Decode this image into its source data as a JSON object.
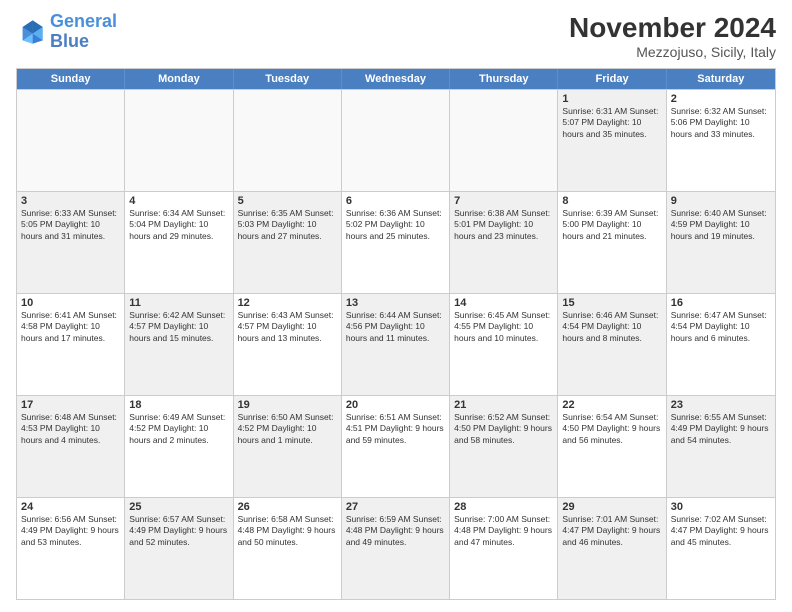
{
  "header": {
    "logo_line1": "General",
    "logo_line2": "Blue",
    "month_title": "November 2024",
    "location": "Mezzojuso, Sicily, Italy"
  },
  "days_of_week": [
    "Sunday",
    "Monday",
    "Tuesday",
    "Wednesday",
    "Thursday",
    "Friday",
    "Saturday"
  ],
  "rows": [
    [
      {
        "day": "",
        "info": "",
        "empty": true
      },
      {
        "day": "",
        "info": "",
        "empty": true
      },
      {
        "day": "",
        "info": "",
        "empty": true
      },
      {
        "day": "",
        "info": "",
        "empty": true
      },
      {
        "day": "",
        "info": "",
        "empty": true
      },
      {
        "day": "1",
        "info": "Sunrise: 6:31 AM\nSunset: 5:07 PM\nDaylight: 10 hours and 35 minutes.",
        "shaded": true
      },
      {
        "day": "2",
        "info": "Sunrise: 6:32 AM\nSunset: 5:06 PM\nDaylight: 10 hours and 33 minutes.",
        "shaded": false
      }
    ],
    [
      {
        "day": "3",
        "info": "Sunrise: 6:33 AM\nSunset: 5:05 PM\nDaylight: 10 hours and 31 minutes.",
        "shaded": true
      },
      {
        "day": "4",
        "info": "Sunrise: 6:34 AM\nSunset: 5:04 PM\nDaylight: 10 hours and 29 minutes.",
        "shaded": false
      },
      {
        "day": "5",
        "info": "Sunrise: 6:35 AM\nSunset: 5:03 PM\nDaylight: 10 hours and 27 minutes.",
        "shaded": true
      },
      {
        "day": "6",
        "info": "Sunrise: 6:36 AM\nSunset: 5:02 PM\nDaylight: 10 hours and 25 minutes.",
        "shaded": false
      },
      {
        "day": "7",
        "info": "Sunrise: 6:38 AM\nSunset: 5:01 PM\nDaylight: 10 hours and 23 minutes.",
        "shaded": true
      },
      {
        "day": "8",
        "info": "Sunrise: 6:39 AM\nSunset: 5:00 PM\nDaylight: 10 hours and 21 minutes.",
        "shaded": false
      },
      {
        "day": "9",
        "info": "Sunrise: 6:40 AM\nSunset: 4:59 PM\nDaylight: 10 hours and 19 minutes.",
        "shaded": true
      }
    ],
    [
      {
        "day": "10",
        "info": "Sunrise: 6:41 AM\nSunset: 4:58 PM\nDaylight: 10 hours and 17 minutes.",
        "shaded": false
      },
      {
        "day": "11",
        "info": "Sunrise: 6:42 AM\nSunset: 4:57 PM\nDaylight: 10 hours and 15 minutes.",
        "shaded": true
      },
      {
        "day": "12",
        "info": "Sunrise: 6:43 AM\nSunset: 4:57 PM\nDaylight: 10 hours and 13 minutes.",
        "shaded": false
      },
      {
        "day": "13",
        "info": "Sunrise: 6:44 AM\nSunset: 4:56 PM\nDaylight: 10 hours and 11 minutes.",
        "shaded": true
      },
      {
        "day": "14",
        "info": "Sunrise: 6:45 AM\nSunset: 4:55 PM\nDaylight: 10 hours and 10 minutes.",
        "shaded": false
      },
      {
        "day": "15",
        "info": "Sunrise: 6:46 AM\nSunset: 4:54 PM\nDaylight: 10 hours and 8 minutes.",
        "shaded": true
      },
      {
        "day": "16",
        "info": "Sunrise: 6:47 AM\nSunset: 4:54 PM\nDaylight: 10 hours and 6 minutes.",
        "shaded": false
      }
    ],
    [
      {
        "day": "17",
        "info": "Sunrise: 6:48 AM\nSunset: 4:53 PM\nDaylight: 10 hours and 4 minutes.",
        "shaded": true
      },
      {
        "day": "18",
        "info": "Sunrise: 6:49 AM\nSunset: 4:52 PM\nDaylight: 10 hours and 2 minutes.",
        "shaded": false
      },
      {
        "day": "19",
        "info": "Sunrise: 6:50 AM\nSunset: 4:52 PM\nDaylight: 10 hours and 1 minute.",
        "shaded": true
      },
      {
        "day": "20",
        "info": "Sunrise: 6:51 AM\nSunset: 4:51 PM\nDaylight: 9 hours and 59 minutes.",
        "shaded": false
      },
      {
        "day": "21",
        "info": "Sunrise: 6:52 AM\nSunset: 4:50 PM\nDaylight: 9 hours and 58 minutes.",
        "shaded": true
      },
      {
        "day": "22",
        "info": "Sunrise: 6:54 AM\nSunset: 4:50 PM\nDaylight: 9 hours and 56 minutes.",
        "shaded": false
      },
      {
        "day": "23",
        "info": "Sunrise: 6:55 AM\nSunset: 4:49 PM\nDaylight: 9 hours and 54 minutes.",
        "shaded": true
      }
    ],
    [
      {
        "day": "24",
        "info": "Sunrise: 6:56 AM\nSunset: 4:49 PM\nDaylight: 9 hours and 53 minutes.",
        "shaded": false
      },
      {
        "day": "25",
        "info": "Sunrise: 6:57 AM\nSunset: 4:49 PM\nDaylight: 9 hours and 52 minutes.",
        "shaded": true
      },
      {
        "day": "26",
        "info": "Sunrise: 6:58 AM\nSunset: 4:48 PM\nDaylight: 9 hours and 50 minutes.",
        "shaded": false
      },
      {
        "day": "27",
        "info": "Sunrise: 6:59 AM\nSunset: 4:48 PM\nDaylight: 9 hours and 49 minutes.",
        "shaded": true
      },
      {
        "day": "28",
        "info": "Sunrise: 7:00 AM\nSunset: 4:48 PM\nDaylight: 9 hours and 47 minutes.",
        "shaded": false
      },
      {
        "day": "29",
        "info": "Sunrise: 7:01 AM\nSunset: 4:47 PM\nDaylight: 9 hours and 46 minutes.",
        "shaded": true
      },
      {
        "day": "30",
        "info": "Sunrise: 7:02 AM\nSunset: 4:47 PM\nDaylight: 9 hours and 45 minutes.",
        "shaded": false
      }
    ]
  ]
}
